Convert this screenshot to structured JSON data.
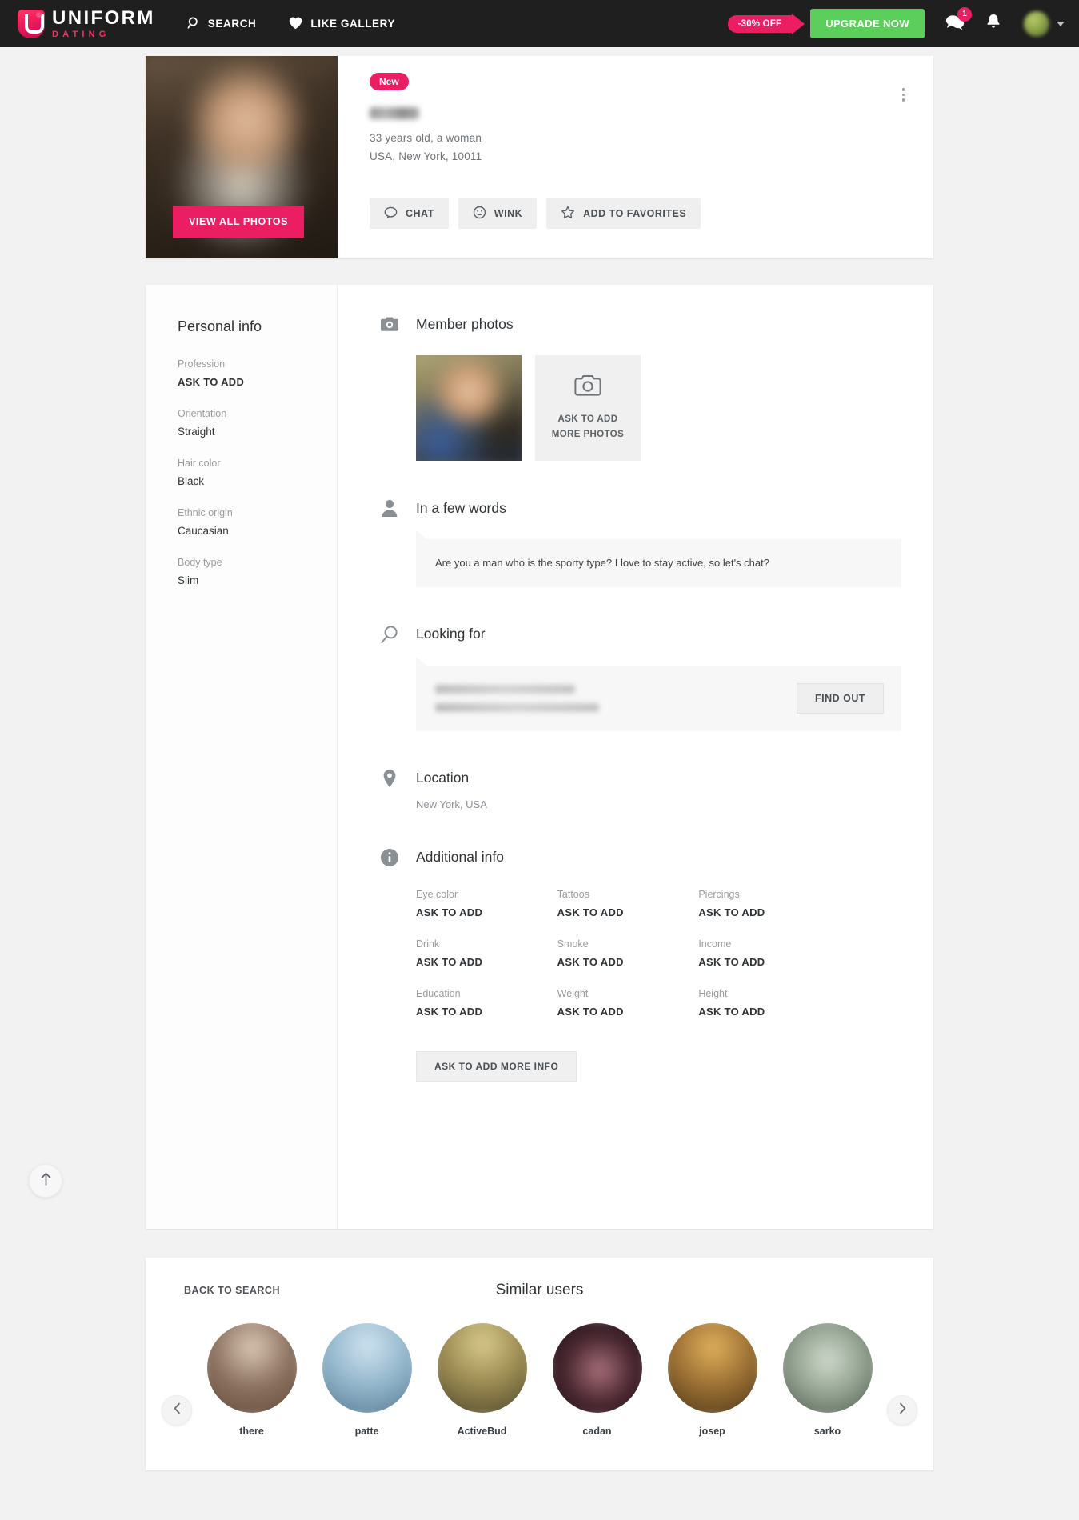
{
  "header": {
    "brand_top": "UNIFORM",
    "brand_bottom": "DATING",
    "nav": [
      {
        "label": "SEARCH",
        "icon": "search-icon"
      },
      {
        "label": "LIKE GALLERY",
        "icon": "heart-icon"
      }
    ],
    "discount_badge": "-30% OFF",
    "upgrade_label": "UPGRADE NOW",
    "message_count": "1",
    "accent_pink": "#ec1e63",
    "upgrade_green": "#5bce5b",
    "bar_bg": "#1f1f1f"
  },
  "profile": {
    "new_badge": "New",
    "username": "",
    "age_line": "33 years old, a woman",
    "location_line": "USA, New York, 10011",
    "view_photos_label": "VIEW ALL PHOTOS",
    "actions": [
      {
        "label": "CHAT",
        "icon": "chat-bubble-icon"
      },
      {
        "label": "WINK",
        "icon": "smiley-icon"
      },
      {
        "label": "ADD TO FAVORITES",
        "icon": "star-icon"
      }
    ]
  },
  "sidebar": {
    "title": "Personal info",
    "fields": [
      {
        "label": "Profession",
        "value": "ASK TO ADD",
        "strong": true
      },
      {
        "label": "Orientation",
        "value": "Straight",
        "strong": false
      },
      {
        "label": "Hair color",
        "value": "Black",
        "strong": false
      },
      {
        "label": "Ethnic origin",
        "value": "Caucasian",
        "strong": false
      },
      {
        "label": "Body type",
        "value": "Slim",
        "strong": false
      }
    ]
  },
  "sections": {
    "photos": {
      "title": "Member photos",
      "icon": "camera-icon",
      "add_label": "ASK TO ADD MORE PHOTOS"
    },
    "about": {
      "title": "In a few words",
      "icon": "person-icon",
      "text": "Are you a man who is the sporty type? I love to stay active, so let's chat?"
    },
    "looking_for": {
      "title": "Looking for",
      "icon": "magnifier-icon",
      "button_label": "FIND OUT"
    },
    "location": {
      "title": "Location",
      "icon": "map-pin-icon",
      "value": "New York, USA"
    },
    "additional": {
      "title": "Additional info",
      "icon": "info-icon",
      "items": [
        {
          "label": "Eye color",
          "value": "ASK TO ADD"
        },
        {
          "label": "Tattoos",
          "value": "ASK TO ADD"
        },
        {
          "label": "Piercings",
          "value": "ASK TO ADD"
        },
        {
          "label": "Drink",
          "value": "ASK TO ADD"
        },
        {
          "label": "Smoke",
          "value": "ASK TO ADD"
        },
        {
          "label": "Income",
          "value": "ASK TO ADD"
        },
        {
          "label": "Education",
          "value": "ASK TO ADD"
        },
        {
          "label": "Weight",
          "value": "ASK TO ADD"
        },
        {
          "label": "Height",
          "value": "ASK TO ADD"
        }
      ],
      "more_button_label": "ASK TO ADD MORE INFO"
    }
  },
  "similar": {
    "back_label": "BACK TO SEARCH",
    "title": "Similar users",
    "users": [
      {
        "name": "there",
        "c1": "#d9c6b4",
        "c2": "#8d7260",
        "c3": "#5a4436"
      },
      {
        "name": "patte",
        "c1": "#cfe3ef",
        "c2": "#8fb3c9",
        "c3": "#4d6f86"
      },
      {
        "name": "ActiveBud",
        "c1": "#d8c98a",
        "c2": "#9a8a52",
        "c3": "#3f3a24"
      },
      {
        "name": "cadan",
        "c1": "#a8707a",
        "c2": "#4a2730",
        "c3": "#140c10"
      },
      {
        "name": "josep",
        "c1": "#e0b05c",
        "c2": "#9a6f33",
        "c3": "#3d2c14"
      },
      {
        "name": "sarko",
        "c1": "#cfd9cc",
        "c2": "#97a694",
        "c3": "#3f4a42"
      }
    ]
  }
}
